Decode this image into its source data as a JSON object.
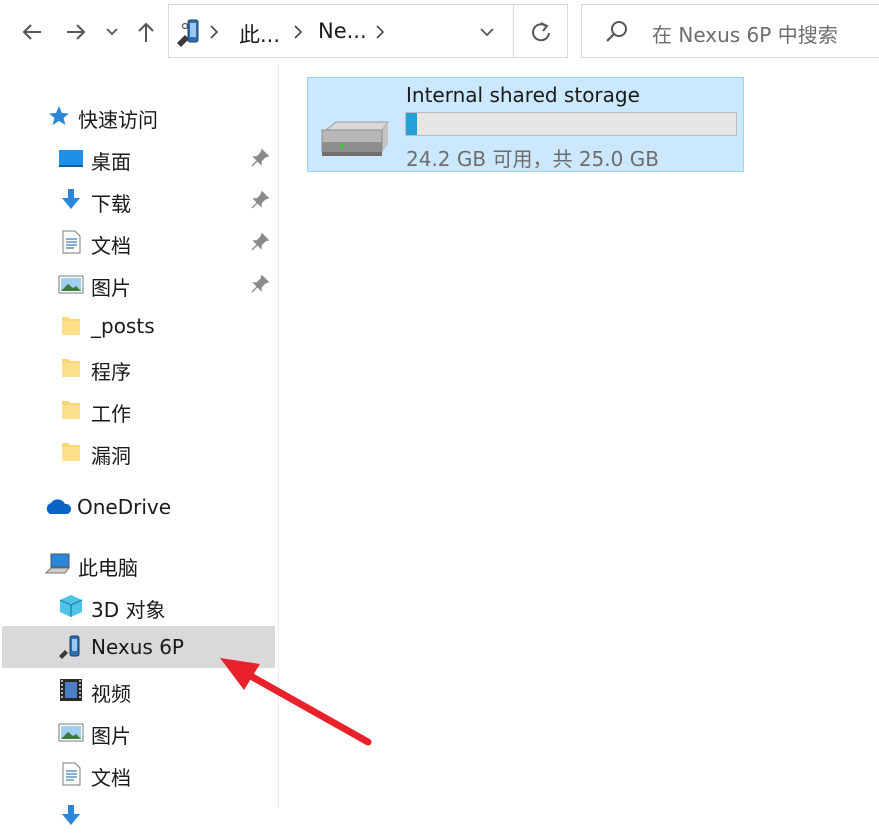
{
  "toolbar": {
    "back_icon": "arrow-left-icon",
    "forward_icon": "arrow-right-icon",
    "recent_icon": "chevron-down-icon",
    "up_icon": "arrow-up-icon",
    "breadcrumb": [
      "此...",
      "Ne..."
    ],
    "refresh_icon": "refresh-icon",
    "search_placeholder": "在 Nexus 6P 中搜索"
  },
  "sidebar": {
    "quick_access": {
      "label": "快速访问",
      "icon": "star-icon"
    },
    "pinned": [
      {
        "label": "桌面",
        "icon": "desktop-icon"
      },
      {
        "label": "下载",
        "icon": "download-icon"
      },
      {
        "label": "文档",
        "icon": "document-icon"
      },
      {
        "label": "图片",
        "icon": "picture-icon"
      }
    ],
    "folders": [
      {
        "label": "_posts",
        "icon": "folder-icon"
      },
      {
        "label": "程序",
        "icon": "folder-icon"
      },
      {
        "label": "工作",
        "icon": "folder-icon"
      },
      {
        "label": "漏洞",
        "icon": "folder-icon"
      }
    ],
    "onedrive": {
      "label": "OneDrive",
      "icon": "cloud-icon"
    },
    "this_pc": {
      "label": "此电脑",
      "icon": "computer-icon"
    },
    "pc_items": [
      {
        "label": "3D 对象",
        "icon": "cube-icon"
      },
      {
        "label": "Nexus 6P",
        "icon": "phone-icon",
        "selected": true
      },
      {
        "label": "视频",
        "icon": "video-icon"
      },
      {
        "label": "图片",
        "icon": "picture-icon"
      },
      {
        "label": "文档",
        "icon": "document-icon"
      }
    ]
  },
  "content": {
    "storage": {
      "name": "Internal shared storage",
      "free_text": "24.2 GB 可用，共 25.0 GB",
      "used_fraction": 0.032,
      "icon": "drive-icon"
    }
  },
  "colors": {
    "selection_bg": "#cce8ff",
    "selection_border": "#99d1ff",
    "capacity_fill": "#26a0da",
    "sidebar_selected": "#d9d9d9",
    "annotation_arrow": "#e8212b"
  }
}
